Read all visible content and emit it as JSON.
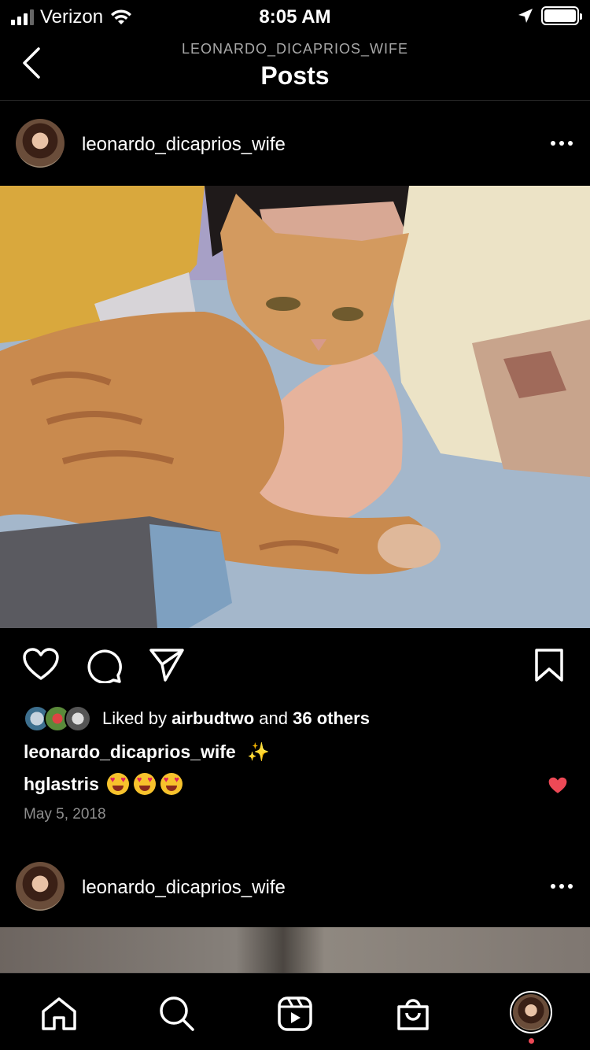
{
  "status_bar": {
    "carrier": "Verizon",
    "time": "8:05 AM",
    "icons": [
      "signal-icon",
      "wifi-icon",
      "location-icon",
      "battery-icon"
    ]
  },
  "nav": {
    "subtitle": "LEONARDO_DICAPRIOS_WIFE",
    "title": "Posts",
    "back_icon": "chevron-left-icon"
  },
  "post": {
    "username": "leonardo_dicaprios_wife",
    "photo_subject": "orange tabby cat",
    "likes": {
      "prefix": "Liked by ",
      "liked_by": "airbudtwo",
      "middle": " and ",
      "others": "36 others"
    },
    "caption_user": "leonardo_dicaprios_wife",
    "caption_text": "✨",
    "comment": {
      "user": "hglastris",
      "emoji": "heart-eyes-emoji",
      "emoji_count": 3
    },
    "date": "May 5, 2018"
  },
  "next_post": {
    "username": "leonardo_dicaprios_wife"
  },
  "tabs": [
    "home-icon",
    "search-icon",
    "reels-icon",
    "shop-icon",
    "profile-avatar"
  ],
  "colors": {
    "background": "#000000",
    "like_red": "#ed4956",
    "secondary_text": "#8e8e8e"
  }
}
